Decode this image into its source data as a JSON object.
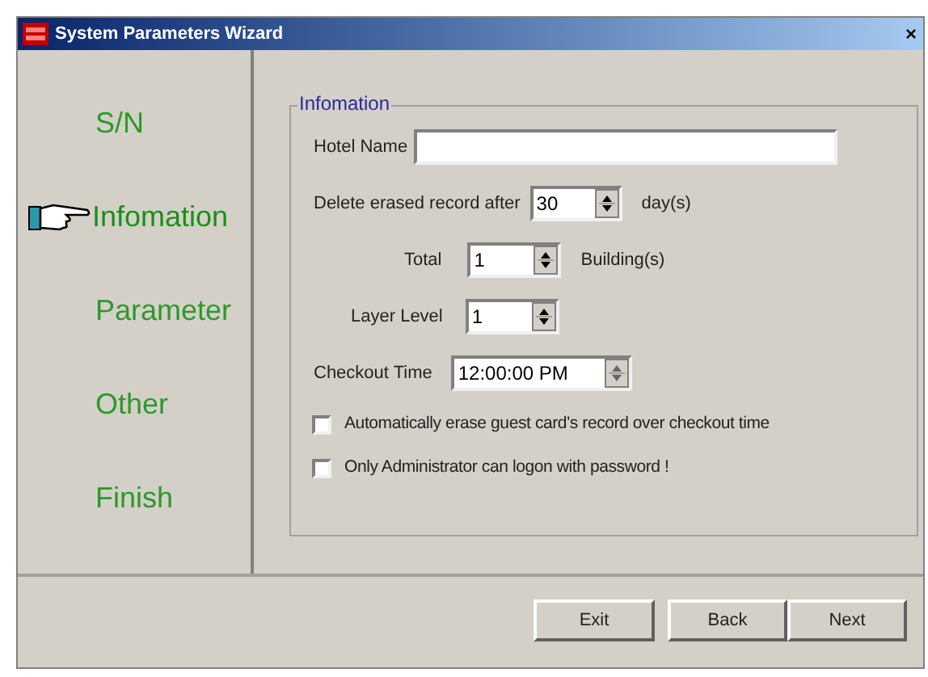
{
  "window": {
    "title": "System Parameters Wizard",
    "close": "×"
  },
  "steps": [
    {
      "label": "S/N",
      "selected": false
    },
    {
      "label": "Infomation",
      "selected": true
    },
    {
      "label": "Parameter",
      "selected": false
    },
    {
      "label": "Other",
      "selected": false
    },
    {
      "label": "Finish",
      "selected": false
    }
  ],
  "group": {
    "title": "Infomation",
    "hotel_name": {
      "label": "Hotel Name"
    },
    "delete_after": {
      "label": "Delete erased record after",
      "value": "30",
      "unit": "day(s)"
    },
    "total": {
      "label": "Total",
      "value": "1",
      "unit": "Building(s)"
    },
    "layer_level": {
      "label": "Layer Level",
      "value": "1"
    },
    "checkout_time": {
      "label": "Checkout Time",
      "value": "12:00:00 PM"
    },
    "checkboxes": [
      {
        "label": "Automatically erase guest card's record over checkout time",
        "checked": false
      },
      {
        "label": "Only Administrator can logon with password !",
        "checked": false
      }
    ]
  },
  "buttons": [
    "Exit",
    "Back",
    "Next"
  ]
}
